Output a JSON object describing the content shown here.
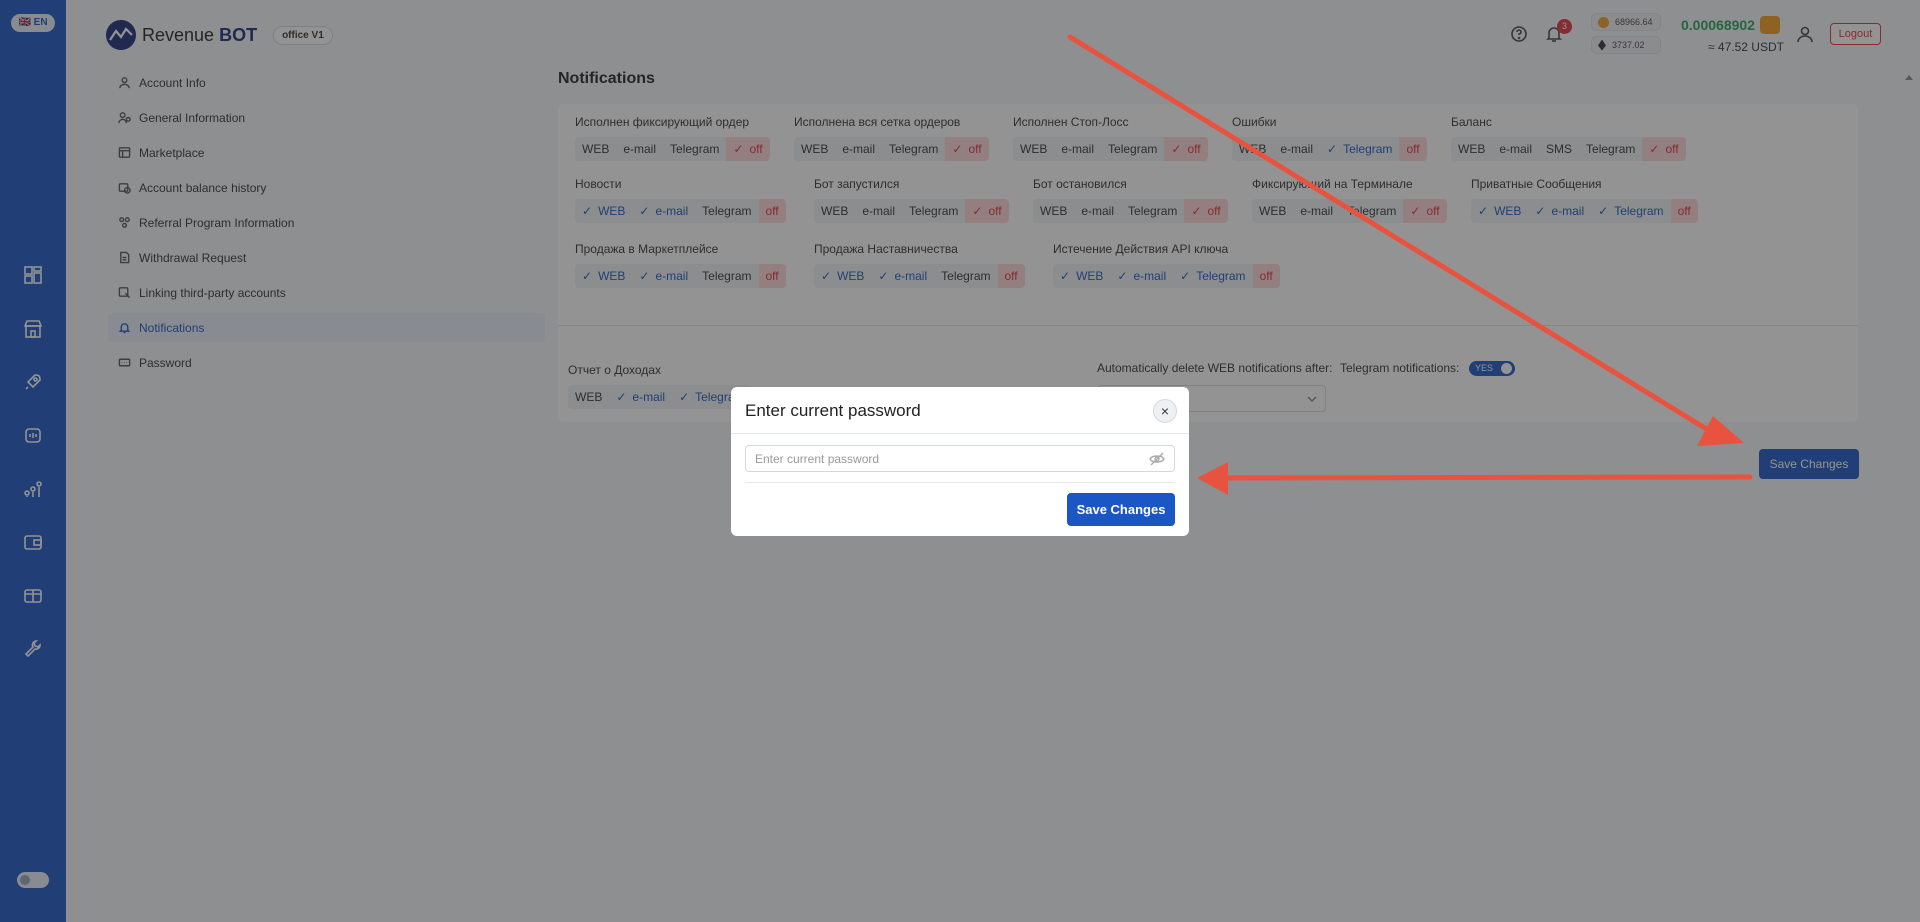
{
  "lang": "🇬🇧 EN",
  "logo": {
    "text_a": "Revenue",
    "text_b": "BOT",
    "office": "office V1"
  },
  "header": {
    "notif_count": "3",
    "btc_price": "68966.64",
    "eth_price": "3737.02",
    "balance": "0.00068902",
    "balance_usdt": "≈ 47.52 USDT",
    "logout": "Logout"
  },
  "sidenav": [
    {
      "label": "Account Info",
      "icon": "user-icon"
    },
    {
      "label": "General Information",
      "icon": "info-user-icon"
    },
    {
      "label": "Marketplace",
      "icon": "store-icon"
    },
    {
      "label": "Account balance history",
      "icon": "history-icon"
    },
    {
      "label": "Referral Program Information",
      "icon": "referral-icon"
    },
    {
      "label": "Withdrawal Request",
      "icon": "document-icon"
    },
    {
      "label": "Linking third-party accounts",
      "icon": "link-icon"
    },
    {
      "label": "Notifications",
      "icon": "bell-icon",
      "active": true
    },
    {
      "label": "Password",
      "icon": "password-icon"
    }
  ],
  "page_title": "Notifications",
  "groups": [
    {
      "title": "Исполнен фиксирующий ордер",
      "chips": [
        "WEB",
        "e-mail",
        "Telegram",
        "off"
      ]
    },
    {
      "title": "Исполнена вся сетка ордеров",
      "chips": [
        "WEB",
        "e-mail",
        "Telegram",
        "off"
      ]
    },
    {
      "title": "Исполнен Стоп-Лосс",
      "chips": [
        "WEB",
        "e-mail",
        "Telegram",
        "off"
      ]
    },
    {
      "title": "Ошибки",
      "chips": [
        "WEB",
        "e-mail",
        "Telegram",
        "off"
      ]
    },
    {
      "title": "Баланс",
      "chips": [
        "WEB",
        "e-mail",
        "SMS",
        "Telegram",
        "off"
      ]
    },
    {
      "title": "Новости",
      "chips": [
        "WEB",
        "e-mail",
        "Telegram",
        "off"
      ]
    },
    {
      "title": "Бот запустился",
      "chips": [
        "WEB",
        "e-mail",
        "Telegram",
        "off"
      ]
    },
    {
      "title": "Бот остановился",
      "chips": [
        "WEB",
        "e-mail",
        "Telegram",
        "off"
      ]
    },
    {
      "title": "Фиксирующий на Терминале",
      "chips": [
        "WEB",
        "e-mail",
        "Telegram",
        "off"
      ]
    },
    {
      "title": "Приватные Сообщения",
      "chips": [
        "WEB",
        "e-mail",
        "Telegram",
        "off"
      ]
    },
    {
      "title": "Продажа в Маркетплейсе",
      "chips": [
        "WEB",
        "e-mail",
        "Telegram",
        "off"
      ]
    },
    {
      "title": "Продажа Наставничества",
      "chips": [
        "WEB",
        "e-mail",
        "Telegram",
        "off"
      ]
    },
    {
      "title": "Истечение Действия API ключа",
      "chips": [
        "WEB",
        "e-mail",
        "Telegram",
        "off"
      ]
    },
    {
      "title": "Отчет о Доходах",
      "chips": [
        "WEB",
        "e-mail",
        "Telegram"
      ]
    }
  ],
  "settings": {
    "auto_delete_label": "Automatically delete WEB notifications after:",
    "telegram_label": "Telegram notifications:",
    "telegram_toggle": "YES"
  },
  "save_changes": "Save Changes",
  "modal": {
    "title": "Enter current password",
    "close": "×",
    "placeholder": "Enter current password",
    "save": "Save Changes"
  },
  "colors": {
    "accent": "#1a56c4",
    "off": "#e0303a",
    "arrow": "#e8533f"
  }
}
